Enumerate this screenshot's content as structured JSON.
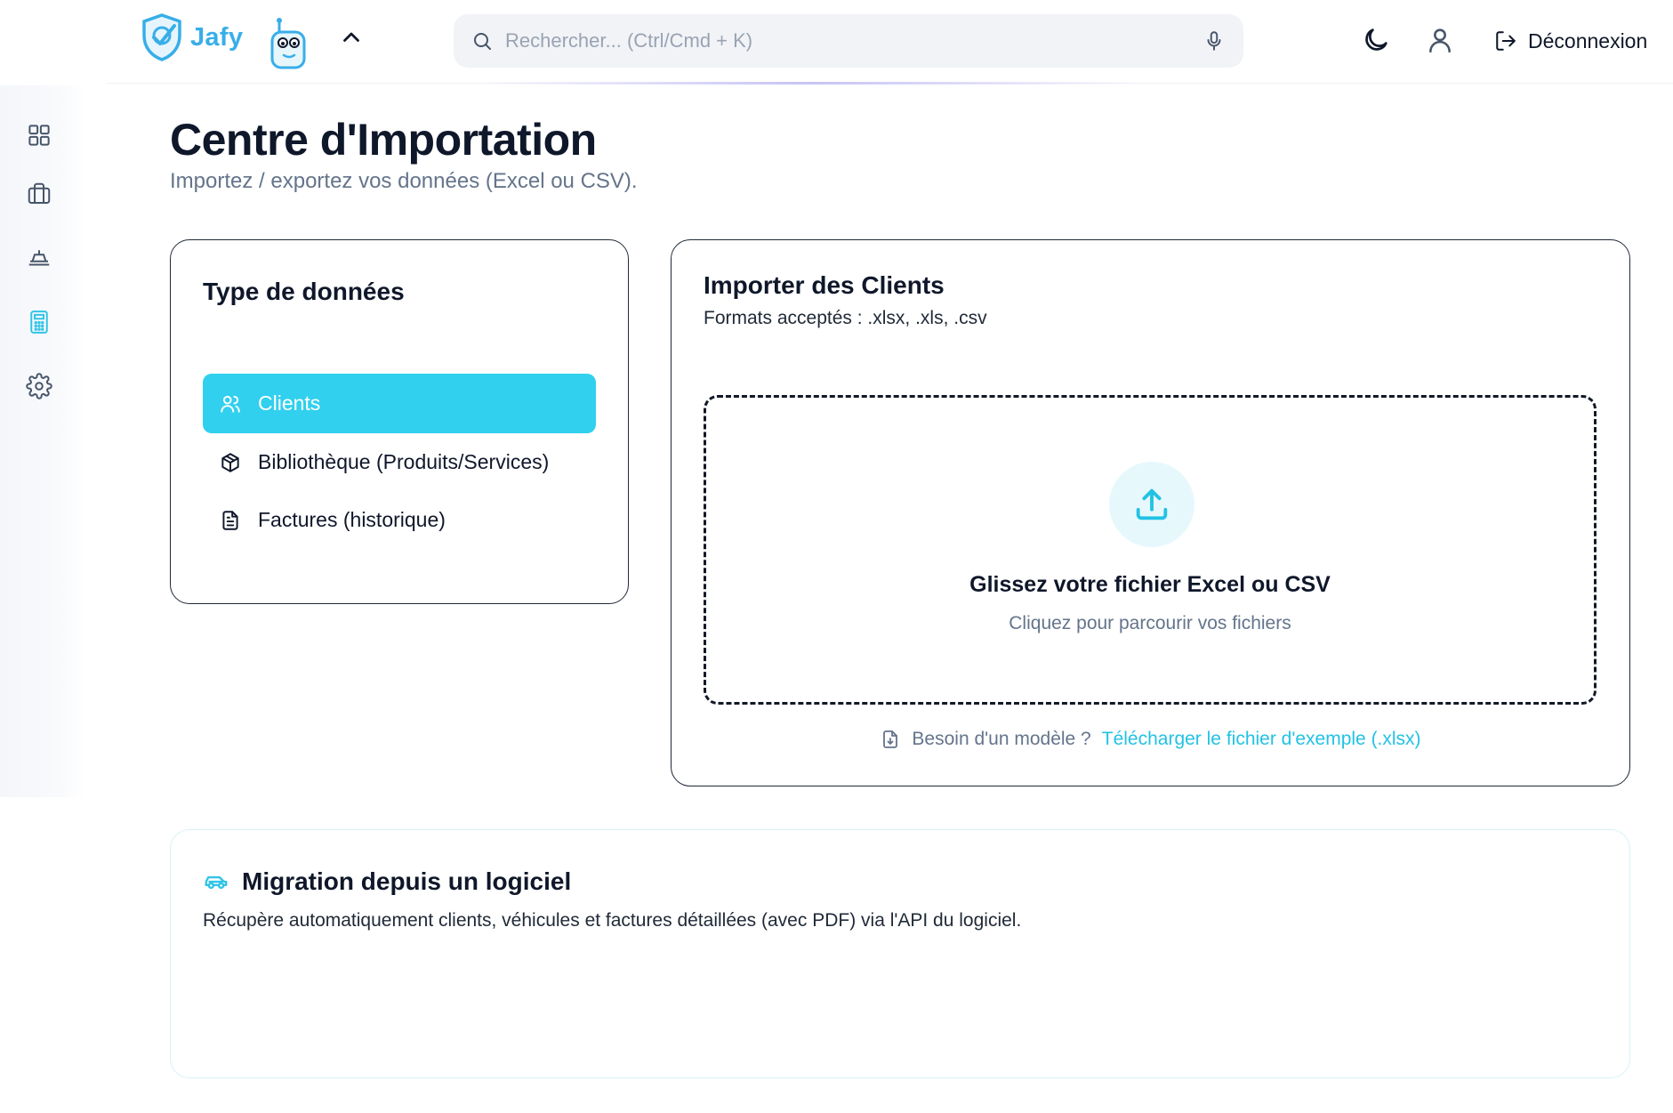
{
  "header": {
    "logo_text": "Jafy",
    "search_placeholder": "Rechercher... (Ctrl/Cmd + K)",
    "logout_label": "Déconnexion"
  },
  "sidebar": {
    "items": [
      {
        "icon": "dashboard-grid-icon"
      },
      {
        "icon": "briefcase-icon"
      },
      {
        "icon": "car-icon"
      },
      {
        "icon": "calculator-icon",
        "active": true
      },
      {
        "icon": "gear-icon"
      }
    ]
  },
  "page": {
    "title": "Centre d'Importation",
    "subtitle": "Importez / exportez vos données (Excel ou CSV)."
  },
  "data_types": {
    "title": "Type de données",
    "items": [
      {
        "label": "Clients",
        "icon": "users-icon",
        "active": true
      },
      {
        "label": "Bibliothèque (Produits/Services)",
        "icon": "package-icon"
      },
      {
        "label": "Factures (historique)",
        "icon": "document-icon"
      }
    ]
  },
  "import": {
    "title": "Importer des Clients",
    "formats": "Formats acceptés : .xlsx, .xls, .csv",
    "drop_title": "Glissez votre fichier Excel ou CSV",
    "drop_subtitle": "Cliquez pour parcourir vos fichiers",
    "template_question": "Besoin d'un modèle ?",
    "template_link": "Télécharger le fichier d'exemple (.xlsx)"
  },
  "migration": {
    "title": "Migration depuis un logiciel",
    "description": "Récupère automatiquement clients, véhicules et factures détaillées (avec PDF) via l'API du logiciel."
  },
  "colors": {
    "accent": "#31d0ee",
    "link": "#22c2e4",
    "brand": "#38aee8"
  }
}
